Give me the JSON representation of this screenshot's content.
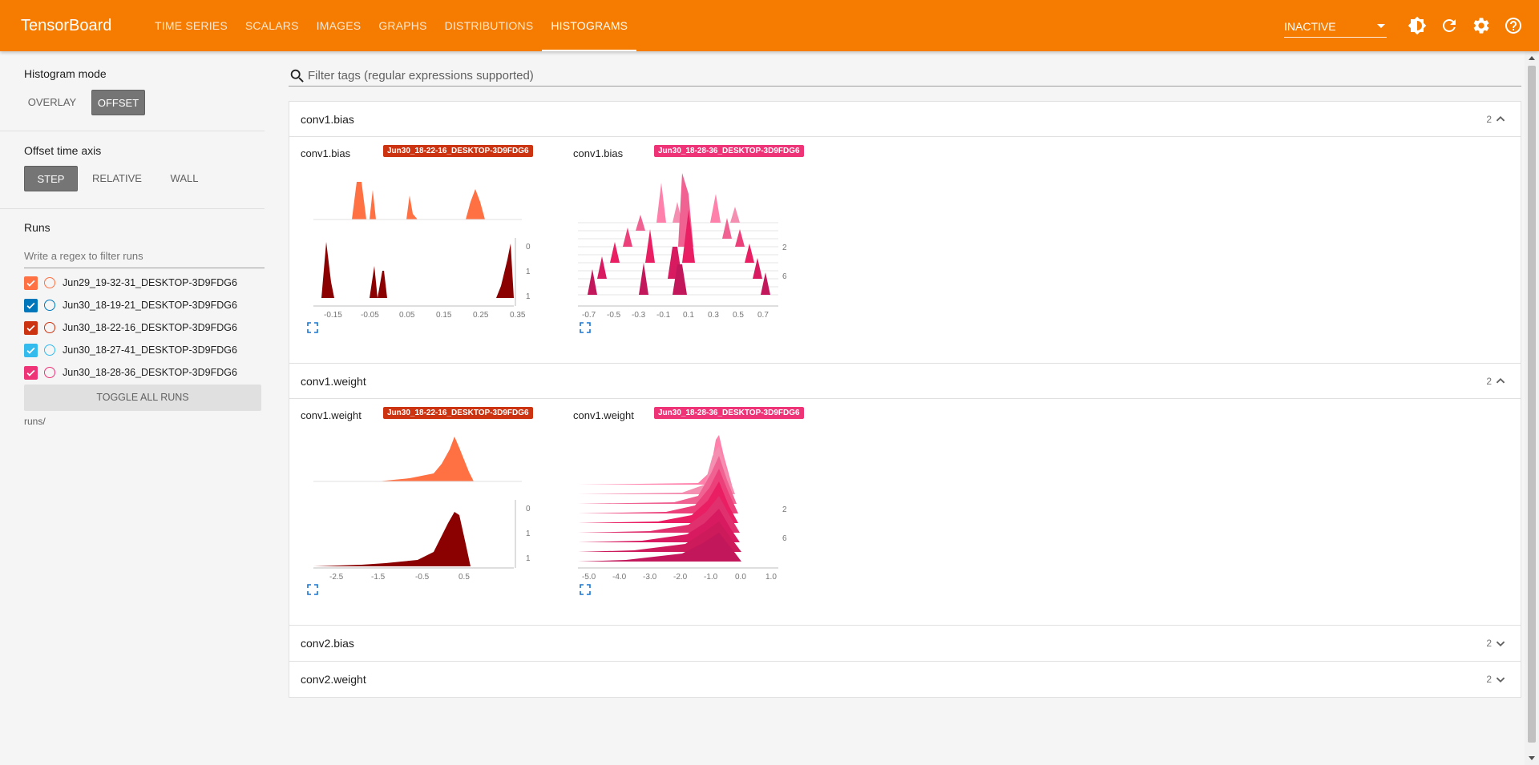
{
  "app": {
    "brand": "TensorBoard",
    "tabs": [
      "TIME SERIES",
      "SCALARS",
      "IMAGES",
      "GRAPHS",
      "DISTRIBUTIONS",
      "HISTOGRAMS"
    ],
    "active_tab": "HISTOGRAMS",
    "run_status": "INACTIVE",
    "icons": [
      "brightness-icon",
      "refresh-icon",
      "settings-icon",
      "help-icon"
    ]
  },
  "sidebar": {
    "histogram_mode": {
      "title": "Histogram mode",
      "options": [
        "OVERLAY",
        "OFFSET"
      ],
      "selected": "OFFSET"
    },
    "offset_axis": {
      "title": "Offset time axis",
      "options": [
        "STEP",
        "RELATIVE",
        "WALL"
      ],
      "selected": "STEP"
    },
    "runs": {
      "title": "Runs",
      "filter_placeholder": "Write a regex to filter runs",
      "items": [
        {
          "name": "Jun29_19-32-31_DESKTOP-3D9FDG6",
          "color": "#ff7043",
          "checked": true
        },
        {
          "name": "Jun30_18-19-21_DESKTOP-3D9FDG6",
          "color": "#0077bb",
          "checked": true
        },
        {
          "name": "Jun30_18-22-16_DESKTOP-3D9FDG6",
          "color": "#cc3311",
          "checked": true
        },
        {
          "name": "Jun30_18-27-41_DESKTOP-3D9FDG6",
          "color": "#33bbee",
          "checked": true
        },
        {
          "name": "Jun30_18-28-36_DESKTOP-3D9FDG6",
          "color": "#ee3377",
          "checked": true
        }
      ],
      "toggle_all_label": "TOGGLE ALL RUNS",
      "log_dir": "runs/"
    }
  },
  "main": {
    "tag_filter_placeholder": "Filter tags (regular expressions supported)",
    "groups": [
      {
        "name": "conv1.bias",
        "count": "2",
        "expanded": true,
        "cards": [
          {
            "tag": "conv1.bias",
            "run": "Jun30_18-22-16_DESKTOP-3D9FDG6",
            "run_color": "#cc3311",
            "x_ticks": [
              "-0.15",
              "-0.05",
              "0.05",
              "0.15",
              "0.25",
              "0.35"
            ],
            "y_ticks": [
              "0",
              "1",
              "1"
            ]
          },
          {
            "tag": "conv1.bias",
            "run": "Jun30_18-28-36_DESKTOP-3D9FDG6",
            "run_color": "#ee3377",
            "x_ticks": [
              "-0.7",
              "-0.5",
              "-0.3",
              "-0.1",
              "0.1",
              "0.3",
              "0.5",
              "0.7"
            ],
            "y_ticks": [
              "2",
              "6"
            ]
          }
        ]
      },
      {
        "name": "conv1.weight",
        "count": "2",
        "expanded": true,
        "cards": [
          {
            "tag": "conv1.weight",
            "run": "Jun30_18-22-16_DESKTOP-3D9FDG6",
            "run_color": "#cc3311",
            "x_ticks": [
              "-2.5",
              "-1.5",
              "-0.5",
              "0.5"
            ],
            "y_ticks": [
              "0",
              "1",
              "1"
            ]
          },
          {
            "tag": "conv1.weight",
            "run": "Jun30_18-28-36_DESKTOP-3D9FDG6",
            "run_color": "#ee3377",
            "x_ticks": [
              "-5.0",
              "-4.0",
              "-3.0",
              "-2.0",
              "-1.0",
              "0.0",
              "1.0"
            ],
            "y_ticks": [
              "2",
              "6"
            ]
          }
        ]
      },
      {
        "name": "conv2.bias",
        "count": "2",
        "expanded": false,
        "cards": []
      },
      {
        "name": "conv2.weight",
        "count": "2",
        "expanded": false,
        "cards": []
      }
    ]
  }
}
